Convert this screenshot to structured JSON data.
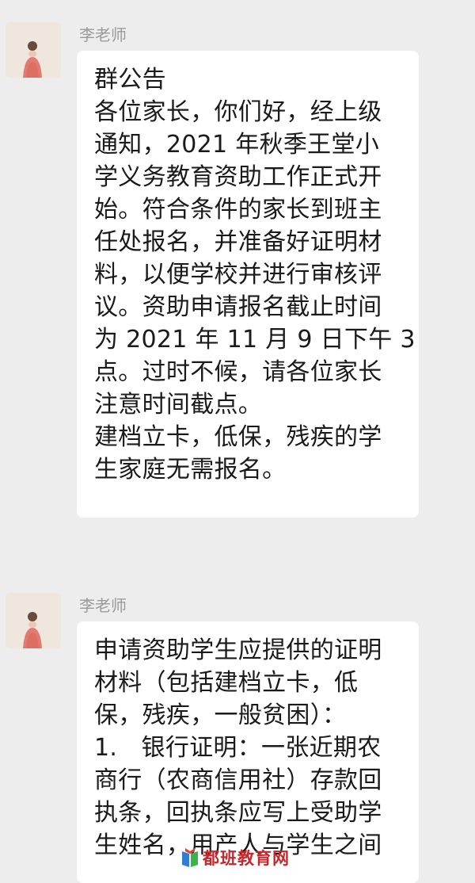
{
  "messages": [
    {
      "sender": "李老师",
      "lines": [
        "群公告",
        "各位家长，你们好，经上级",
        "通知，2021 年秋季王堂小",
        "学义务教育资助工作正式开",
        "始。符合条件的家长到班主",
        "任处报名，并准备好证明材",
        "料，以便学校并进行审核评",
        "议。资助申请报名截止时间",
        "为 2021 年 11 月 9 日下午 3",
        "点。过时不候，请各位家长",
        "注意时间截点。",
        "建档立卡，低保，残疾的学",
        "生家庭无需报名。"
      ]
    },
    {
      "sender": "李老师",
      "lines": [
        "申请资助学生应提供的证明",
        "材料（包括建档立卡，低",
        "保，残疾，一般贫困）：",
        "1.　银行证明：一张近期农",
        "商行（农商信用社）存款回",
        "执条，回执条应写上受助学",
        "生姓名，用产人与学生之间"
      ]
    }
  ],
  "watermark": {
    "text": "都班教育网",
    "icon": "book-logo-icon"
  },
  "colors": {
    "background": "#ededed",
    "bubble": "#ffffff",
    "sender_name": "#9a9a9a",
    "text": "#1a1a1a",
    "watermark": "#c8262b"
  }
}
